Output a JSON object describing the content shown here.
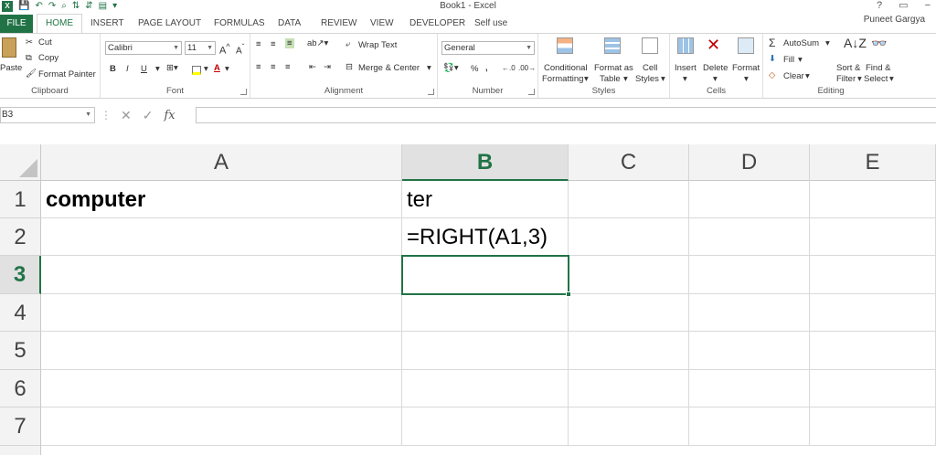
{
  "window": {
    "title": "Book1 - Excel"
  },
  "window_controls": {
    "help": "?",
    "restore": "▭",
    "minimize": "−"
  },
  "tabs": [
    "FILE",
    "HOME",
    "INSERT",
    "PAGE LAYOUT",
    "FORMULAS",
    "DATA",
    "REVIEW",
    "VIEW",
    "DEVELOPER",
    "Self use"
  ],
  "active_tab": "HOME",
  "user": "Puneet Gargya",
  "ribbon": {
    "clipboard": {
      "label": "Clipboard",
      "paste": "Paste",
      "cut": "Cut",
      "copy": "Copy",
      "format_painter": "Format Painter"
    },
    "font": {
      "label": "Font",
      "font_name": "Calibri",
      "font_size": "11",
      "bold": "B",
      "italic": "I",
      "underline": "U"
    },
    "alignment": {
      "label": "Alignment",
      "wrap_text": "Wrap Text",
      "merge_center": "Merge & Center"
    },
    "number": {
      "label": "Number",
      "format": "General",
      "percent": "%",
      "comma": ","
    },
    "styles": {
      "label": "Styles",
      "conditional_1": "Conditional",
      "conditional_2": "Formatting",
      "format_as_1": "Format as",
      "format_as_2": "Table",
      "cell_1": "Cell",
      "cell_2": "Styles"
    },
    "cells": {
      "label": "Cells",
      "insert": "Insert",
      "delete": "Delete",
      "format": "Format"
    },
    "editing": {
      "label": "Editing",
      "autosum": "AutoSum",
      "fill": "Fill",
      "clear": "Clear",
      "sort_1": "Sort &",
      "sort_2": "Filter",
      "find_1": "Find &",
      "find_2": "Select"
    }
  },
  "formula_bar": {
    "name_box": "B3",
    "fx": "fx",
    "formula": ""
  },
  "sheet": {
    "columns": [
      "A",
      "B",
      "C",
      "D",
      "E"
    ],
    "selected_column": "B",
    "rows": [
      "1",
      "2",
      "3",
      "4",
      "5",
      "6",
      "7"
    ],
    "selected_row": "3",
    "cells": {
      "A1": "computer",
      "B1": "ter",
      "B2": "=RIGHT(A1,3)"
    },
    "active_cell": "B3"
  },
  "colors": {
    "accent": "#217346"
  }
}
